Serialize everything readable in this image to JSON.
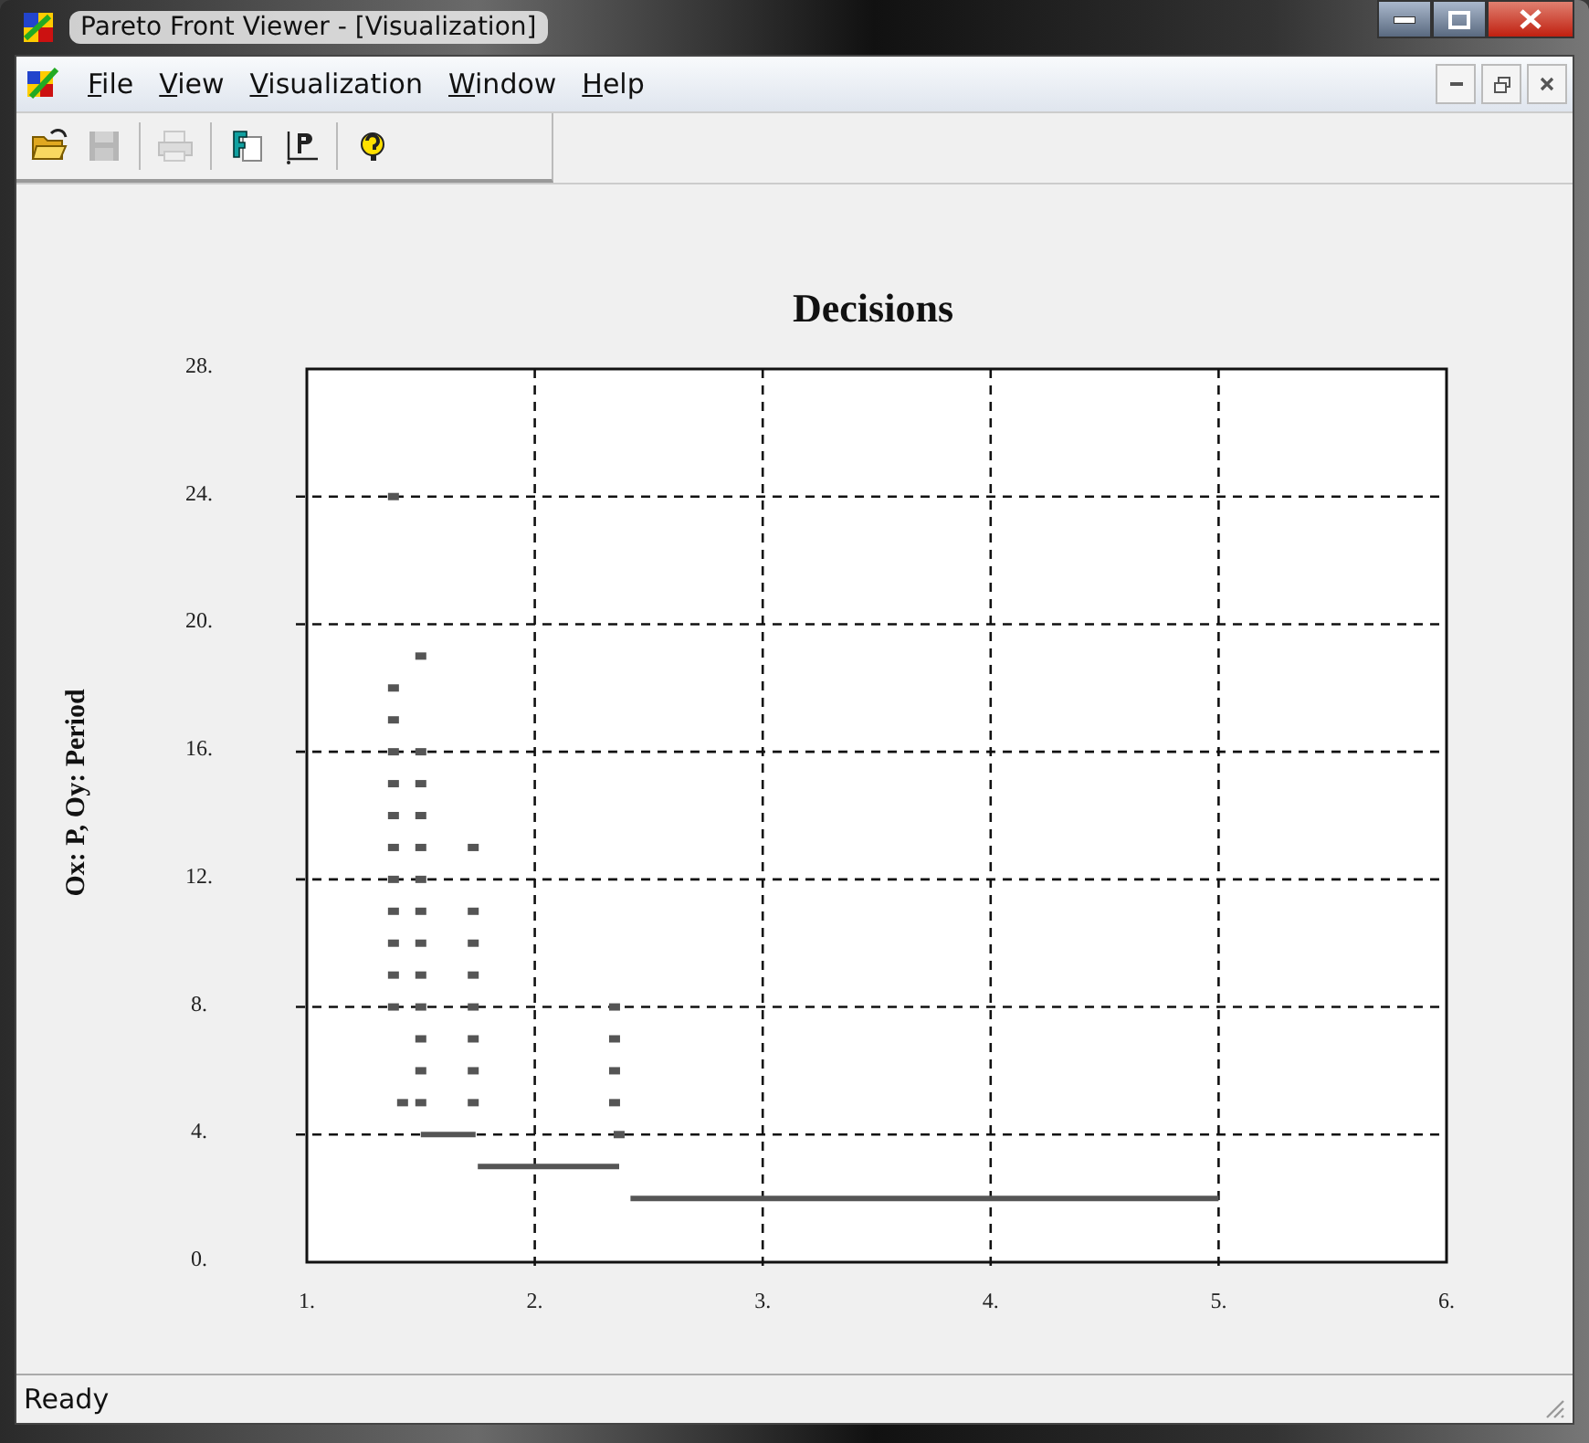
{
  "window": {
    "title": "Pareto Front Viewer - [Visualization]"
  },
  "menu": [
    {
      "label": "File"
    },
    {
      "label": "View"
    },
    {
      "label": "Visualization"
    },
    {
      "label": "Window"
    },
    {
      "label": "Help"
    }
  ],
  "toolbar": [
    [
      {
        "kind": "open",
        "disabled": false
      },
      {
        "kind": "save",
        "disabled": true
      }
    ],
    [
      {
        "kind": "print",
        "disabled": true
      }
    ],
    [
      {
        "kind": "front",
        "disabled": false
      },
      {
        "kind": "pareto",
        "disabled": false
      }
    ],
    [
      {
        "kind": "help",
        "disabled": false
      }
    ]
  ],
  "chart_data": {
    "type": "scatter",
    "grid": true,
    "title": "Decisions",
    "ylabel": "Ox: P,  Oy: Period",
    "xlim": [
      1,
      6
    ],
    "ylim": [
      0,
      28
    ],
    "xticks": [
      {
        "value": 1,
        "label": "1."
      },
      {
        "value": 2,
        "label": "2."
      },
      {
        "value": 3,
        "label": "3."
      },
      {
        "value": 4,
        "label": "4."
      },
      {
        "value": 5,
        "label": "5."
      },
      {
        "value": 6,
        "label": "6."
      }
    ],
    "yticks": [
      {
        "value": 0,
        "label": "0."
      },
      {
        "value": 4,
        "label": "4."
      },
      {
        "value": 8,
        "label": "8."
      },
      {
        "value": 12,
        "label": "12."
      },
      {
        "value": 16,
        "label": "16."
      },
      {
        "value": 20,
        "label": "20."
      },
      {
        "value": 24,
        "label": "24."
      },
      {
        "value": 28,
        "label": "28."
      }
    ],
    "series": [
      {
        "color": "#555555",
        "x": [
          1.38,
          1.38,
          1.38,
          1.38,
          1.38,
          1.38,
          1.38,
          1.38,
          1.38,
          1.38,
          1.38,
          1.38,
          1.42,
          1.5,
          1.5,
          1.5,
          1.5,
          1.5,
          1.5,
          1.5,
          1.5,
          1.5,
          1.5,
          1.5,
          1.5,
          1.5,
          1.73,
          1.73,
          1.73,
          1.73,
          1.73,
          1.73,
          1.73,
          1.73,
          2.35,
          2.35,
          2.35,
          2.35,
          2.37
        ],
        "values": [
          24,
          18,
          17,
          16,
          15,
          14,
          13,
          12,
          11,
          10,
          9,
          8,
          5,
          19,
          16,
          15,
          14,
          13,
          12,
          11,
          10,
          9,
          8,
          7,
          6,
          5,
          13,
          11,
          10,
          9,
          8,
          7,
          6,
          5,
          8,
          7,
          6,
          5,
          4
        ]
      },
      {
        "color": "#555555",
        "type": "line",
        "x": [
          1.5,
          1.74,
          null,
          1.75,
          2.37,
          null,
          2.42,
          5.0
        ],
        "values": [
          4,
          4,
          null,
          3,
          3,
          null,
          2,
          2
        ]
      }
    ]
  },
  "status_bar": {
    "text": "Ready"
  }
}
